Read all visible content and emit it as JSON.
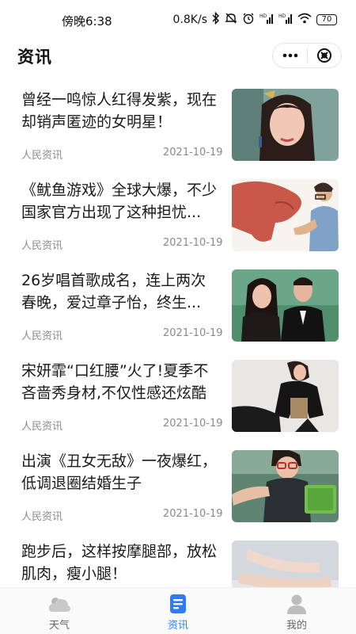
{
  "status_bar": {
    "time": "傍晚6:38",
    "network_speed": "0.8K/s",
    "battery": "70",
    "icons": [
      "bluetooth-icon",
      "mute-icon",
      "alarm-icon",
      "hd-signal-icon",
      "hd-signal-icon",
      "wifi-icon",
      "battery-icon"
    ]
  },
  "header": {
    "title": "资讯",
    "capsule_icons": [
      "more-dots-icon",
      "close-circle-icon"
    ]
  },
  "news": [
    {
      "title": "曾经一鸣惊人红得发紫，现在却销声匿迹的女明星！",
      "source": "人民资讯",
      "date": "2021-10-19",
      "thumb": "actress-portrait-photo"
    },
    {
      "title": "《鱿鱼游戏》全球大爆，不少国家官方出现了这种担忧...",
      "source": "人民资讯",
      "date": "2021-10-19",
      "thumb": "hand-fist-photo"
    },
    {
      "title": "26岁唱首歌成名，连上两次春晚，爱过章子怡，终生...",
      "source": "人民资讯",
      "date": "2021-10-19",
      "thumb": "couple-photo"
    },
    {
      "title": "宋妍霏“口红腰”火了!夏季不吝啬秀身材,不仅性感还炫酷",
      "source": "人民资讯",
      "date": "2021-10-19",
      "thumb": "fashion-photo"
    },
    {
      "title": "出演《丑女无敌》一夜爆红，低调退圈结婚生子",
      "source": "人民资讯",
      "date": "2021-10-19",
      "thumb": "tv-drama-still-photo"
    },
    {
      "title": "跑步后，这样按摩腿部，放松肌肉，瘦小腿！",
      "source": "",
      "date": "",
      "thumb": "legs-photo"
    }
  ],
  "tabs": [
    {
      "label": "天气",
      "icon": "cloud-icon",
      "active": false
    },
    {
      "label": "资讯",
      "icon": "news-doc-icon",
      "active": true
    },
    {
      "label": "我的",
      "icon": "user-icon",
      "active": false
    }
  ],
  "colors": {
    "accent": "#2f7cf6",
    "text": "#1a1a1a",
    "meta": "#8a8a8a"
  }
}
